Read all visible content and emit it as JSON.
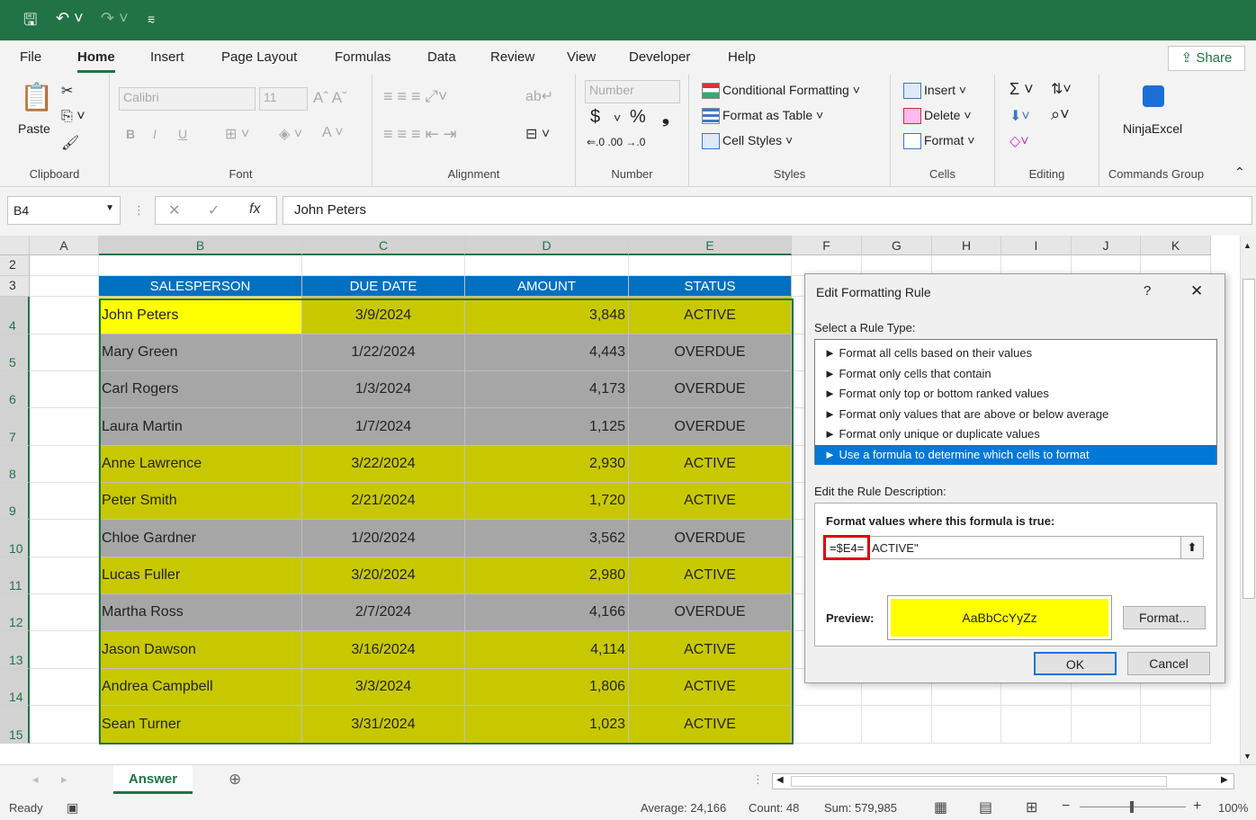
{
  "quick_access": {
    "save_icon": "save-icon",
    "undo_icon": "undo-icon",
    "redo_icon": "redo-icon",
    "customize_icon": "customize-icon"
  },
  "menu": {
    "tabs": [
      "File",
      "Home",
      "Insert",
      "Page Layout",
      "Formulas",
      "Data",
      "Review",
      "View",
      "Developer",
      "Help"
    ],
    "active": "Home",
    "share": "Share"
  },
  "ribbon": {
    "clipboard": {
      "label": "Clipboard",
      "paste": "Paste"
    },
    "font": {
      "label": "Font",
      "name": "Calibri",
      "size": "11",
      "bold": "B",
      "italic": "I",
      "underline": "U"
    },
    "alignment": {
      "label": "Alignment"
    },
    "number": {
      "label": "Number",
      "format": "Number",
      "currency": "$",
      "percent": "%",
      "comma": "❟"
    },
    "styles": {
      "label": "Styles",
      "conditional": "Conditional Formatting",
      "table": "Format as Table",
      "cellstyles": "Cell Styles"
    },
    "cells": {
      "label": "Cells",
      "insert": "Insert",
      "delete": "Delete",
      "format": "Format"
    },
    "editing": {
      "label": "Editing"
    },
    "commands": {
      "label": "Commands Group",
      "ninja": "NinjaExcel"
    }
  },
  "formula_bar": {
    "name_box": "B4",
    "formula": "John Peters",
    "fx": "fx"
  },
  "columns": [
    "A",
    "B",
    "C",
    "D",
    "E",
    "F",
    "G",
    "H",
    "I",
    "J",
    "K"
  ],
  "rows": [
    "2",
    "3",
    "4",
    "5",
    "6",
    "7",
    "8",
    "9",
    "10",
    "11",
    "12",
    "13",
    "14",
    "15"
  ],
  "table": {
    "headers": [
      "SALESPERSON",
      "DUE DATE",
      "AMOUNT",
      "STATUS"
    ],
    "rows": [
      [
        "John Peters",
        "3/9/2024",
        "3,848",
        "ACTIVE"
      ],
      [
        "Mary Green",
        "1/22/2024",
        "4,443",
        "OVERDUE"
      ],
      [
        "Carl Rogers",
        "1/3/2024",
        "4,173",
        "OVERDUE"
      ],
      [
        "Laura Martin",
        "1/7/2024",
        "1,125",
        "OVERDUE"
      ],
      [
        "Anne Lawrence",
        "3/22/2024",
        "2,930",
        "ACTIVE"
      ],
      [
        "Peter Smith",
        "2/21/2024",
        "1,720",
        "ACTIVE"
      ],
      [
        "Chloe Gardner",
        "1/20/2024",
        "3,562",
        "OVERDUE"
      ],
      [
        "Lucas Fuller",
        "3/20/2024",
        "2,980",
        "ACTIVE"
      ],
      [
        "Martha Ross",
        "2/7/2024",
        "4,166",
        "OVERDUE"
      ],
      [
        "Jason Dawson",
        "3/16/2024",
        "4,114",
        "ACTIVE"
      ],
      [
        "Andrea Campbell",
        "3/3/2024",
        "1,806",
        "ACTIVE"
      ],
      [
        "Sean Turner",
        "3/31/2024",
        "1,023",
        "ACTIVE"
      ]
    ],
    "colors": {
      "header": "#0070c0",
      "active": "#c8c800",
      "overdue": "#a6a6a6",
      "selected": "#ffff00"
    }
  },
  "dialog": {
    "title": "Edit Formatting Rule",
    "help": "?",
    "close": "✕",
    "select_label": "Select a Rule Type:",
    "rule_types": [
      "Format all cells based on their values",
      "Format only cells that contain",
      "Format only top or bottom ranked values",
      "Format only values that are above or below average",
      "Format only unique or duplicate values",
      "Use a formula to determine which cells to format"
    ],
    "selected_index": 5,
    "edit_label": "Edit the Rule Description:",
    "formula_label": "Format values where this formula is true:",
    "formula_part1": "=$E4=",
    "formula_part2": "ACTIVE\"",
    "preview_label": "Preview:",
    "preview_text": "AaBbCcYyZz",
    "format_button": "Format...",
    "ok": "OK",
    "cancel": "Cancel"
  },
  "sheet_tabs": {
    "active": "Answer"
  },
  "status": {
    "ready": "Ready",
    "average": "Average: 24,166",
    "count": "Count: 48",
    "sum": "Sum: 579,985",
    "zoom": "100%"
  }
}
